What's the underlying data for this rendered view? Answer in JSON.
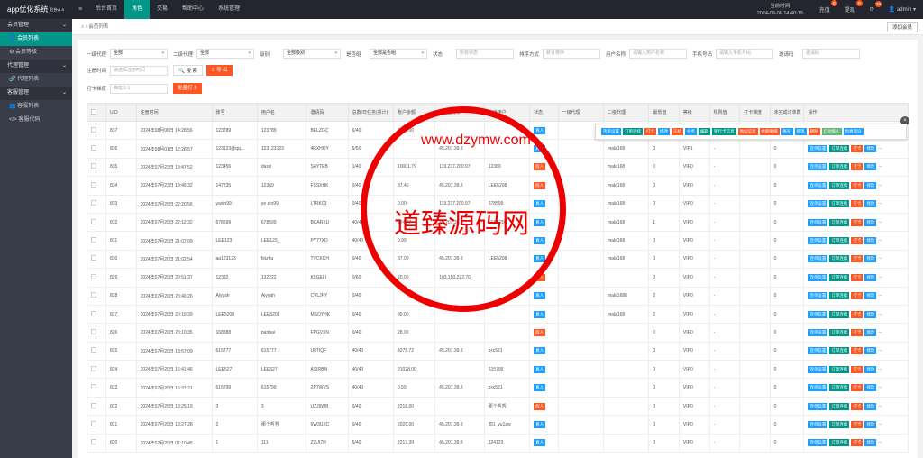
{
  "app": {
    "title": "app优化系统",
    "version": "后台v1.0"
  },
  "topnav": [
    "后台首页",
    "角色",
    "交易",
    "帮助中心",
    "系统管理"
  ],
  "clock": {
    "label": "当前时间",
    "time": "2024-08-06 14:40:19"
  },
  "topright": {
    "recharge": "充值",
    "recharge_count": "0",
    "withdraw": "提现",
    "withdraw_count": "0",
    "msg_count": "19",
    "user": "admin"
  },
  "sidebar": {
    "groups": [
      {
        "label": "会员管理",
        "items": [
          "会员列表",
          "会员等级"
        ]
      },
      {
        "label": "代理管理",
        "items": [
          "代理列表"
        ]
      },
      {
        "label": "客服管理",
        "items": [
          "客服列表",
          "客服代码"
        ]
      }
    ]
  },
  "tabbar": {
    "tab": "会员列表",
    "add": "添加会员"
  },
  "filters": {
    "row1": [
      {
        "label": "一级代理",
        "value": "全部"
      },
      {
        "label": "二级代理",
        "value": "全部"
      },
      {
        "label": "级别",
        "value": "全部级别"
      },
      {
        "label": "是否组",
        "value": "全部是否组"
      },
      {
        "label": "状态",
        "value": "所有状态",
        "ph": true
      },
      {
        "label": "排序方式",
        "value": "默认排序",
        "ph": true
      },
      {
        "label": "用户名称",
        "value": "请输入用户名称",
        "ph": true
      },
      {
        "label": "手机号码",
        "value": "请输入手机号码",
        "ph": true
      },
      {
        "label": "邀请码",
        "value": "邀请码",
        "ph": true
      }
    ],
    "reg_label": "注册时间",
    "reg_ph": "请选择注册时间",
    "search": "搜 索",
    "export": "导 出",
    "print_label": "打卡梯度",
    "print_value": "梯度 1.1",
    "batch": "批量打卡"
  },
  "table": {
    "headers": [
      "UID",
      "注册时间",
      "账号",
      "用户名",
      "邀请码",
      "总数/日任务(累计)",
      "账户余额",
      "最后登录ip",
      "上级用户",
      "状态",
      "一级代理",
      "二级代理",
      "最低值",
      "等级",
      "规则值",
      "打卡梯度",
      "未完成订单数",
      "操作"
    ],
    "rows": [
      [
        "837",
        "2024年08月06日 14:28:56",
        "123789",
        "123789",
        "BELZGC",
        "6/40",
        "1034.00",
        "",
        "",
        "真人",
        "",
        "",
        "0",
        "VIP0",
        "-",
        "",
        "0"
      ],
      [
        "836",
        "2024年08月01日 12:28:57",
        "123123@qq...",
        "123123123",
        "4RXHOY",
        "5/50",
        "",
        "45.207.39.3",
        "",
        "真人",
        "",
        "mala168",
        "0",
        "VIP1",
        "-",
        "",
        "0"
      ],
      [
        "835",
        "2024年07月23日 19:47:52",
        "123456",
        "dasd",
        "SAYTEB",
        "1/40",
        "10001.79",
        "119.237.200.97",
        "12369",
        "假人",
        "",
        "mala168",
        "0",
        "VIP0",
        "-",
        "",
        "0"
      ],
      [
        "834",
        "2024年07月23日 19:46:32",
        "147235",
        "12369",
        "FSSXHK",
        "0/40",
        "37.46",
        "45.207.39.3",
        "LEE5208",
        "假人",
        "",
        "mala168",
        "0",
        "VIP0",
        "-",
        "",
        "0"
      ],
      [
        "833",
        "2024年07月20日 22:20:56",
        "yaxin99",
        "ye sto99",
        "LTRK03",
        "0/40",
        "0.00",
        "119.237.200.97",
        "678599",
        "真人",
        "",
        "mala168",
        "0",
        "VIP0",
        "-",
        "",
        "0"
      ],
      [
        "832",
        "2024年07月20日 22:12:32",
        "678599",
        "678599",
        "BCARXU",
        "40/40",
        "124.77",
        "45.207.39.3",
        "LEE5208",
        "真人",
        "",
        "mala168",
        "1",
        "VIP0",
        "-",
        "",
        "0"
      ],
      [
        "831",
        "2024年07月20日 21:07:09",
        "LEE123",
        "LEE123_",
        "PY77XD",
        "40/40",
        "0.99",
        "",
        "",
        "真人",
        "",
        "mala168",
        "0",
        "VIP0",
        "-",
        "",
        "0"
      ],
      [
        "830",
        "2024年07月20日 21:02:54",
        "aa123123",
        "feizhu",
        "TVCKCH",
        "0/40",
        "37.00",
        "45.207.39.3",
        "LEE5208",
        "真人",
        "",
        "mala168",
        "0",
        "VIP0",
        "-",
        "",
        "0"
      ],
      [
        "829",
        "2024年07月20日 20:51:37",
        "12332",
        "132222",
        "K5GELI",
        "0/60",
        "20.00",
        "103.150.222.70",
        "",
        "假人",
        "",
        "",
        "0",
        "VIP0",
        "-",
        "",
        "0"
      ],
      [
        "828",
        "2024年07月20日 20:46:26",
        "Aiyyah",
        "Aiyyah",
        "CVLJPY",
        "0/40",
        "",
        "",
        "",
        "真人",
        "",
        "mala1688",
        "2",
        "VIP0",
        "-",
        "",
        "0"
      ],
      [
        "827",
        "2024年07月20日 20:19:39",
        "LEE5208",
        "LEE5208",
        "MSQYHK",
        "0/40",
        "30.00",
        "",
        "",
        "真人",
        "",
        "mala168",
        "2",
        "VIP0",
        "-",
        "",
        "0"
      ],
      [
        "826",
        "2024年07月20日 20:10:35",
        "168888",
        "panhai",
        "FPGVXN",
        "0/40",
        "28.00",
        "",
        "",
        "假人",
        "",
        "",
        "0",
        "VIP0",
        "-",
        "",
        "0"
      ],
      [
        "825",
        "2024年07月20日 18:57:09",
        "615777",
        "615777",
        "U8TIQF",
        "40/40",
        "3275.72",
        "45.207.39.3",
        "zxc521",
        "真人",
        "",
        "",
        "0",
        "VIP0",
        "-",
        "",
        "0"
      ],
      [
        "824",
        "2024年07月20日 16:41:46",
        "LEE527",
        "LEE527",
        "ASIRBN",
        "40/40",
        "21028.00",
        "",
        "615799",
        "真人",
        "",
        "",
        "0",
        "VIP0",
        "-",
        "",
        "0"
      ],
      [
        "823",
        "2024年07月20日 16:37:21",
        "615799",
        "615799",
        "ZP7WVS",
        "40/40",
        "0.59",
        "45.207.39.3",
        "zxc521",
        "真人",
        "",
        "",
        "0",
        "VIP0",
        "-",
        "",
        "0"
      ],
      [
        "822",
        "2024年07月20日 13:25:19",
        "3",
        "3",
        "UZJ9WB",
        "0/40",
        "2218.00",
        "",
        "那个哲哲",
        "假人",
        "",
        "",
        "0",
        "VIP0",
        "-",
        "",
        "0"
      ],
      [
        "821",
        "2024年07月20日 13:27:28",
        "2",
        "那个哲哲",
        "6W3UXC",
        "0/40",
        "2028.00",
        "45.207.39.3",
        "四1_yu1aw",
        "真人",
        "",
        "",
        "0",
        "VIP0",
        "-",
        "",
        "0"
      ],
      [
        "820",
        "2024年07月20日 01:10:45",
        "1",
        "111",
        "Z2UI7H",
        "5/40",
        "2217.39",
        "45.207.39.3",
        "324123",
        "真人",
        "",
        "",
        "0",
        "VIP0",
        "-",
        "",
        "0"
      ]
    ],
    "actions": [
      "连单设置",
      "订单连续",
      "打卡",
      "修改"
    ],
    "more": "..."
  },
  "popup": [
    "连单设置",
    "订单连续",
    "打卡",
    "修改",
    "冻结",
    "业务",
    "编辑",
    "银行卡信息",
    "地址信息",
    "余额明细",
    "账号",
    "提现",
    "删除",
    "启动假人",
    "伪真假设"
  ],
  "watermark": {
    "center": "道臻源码网",
    "url": "www.dzymw.com"
  }
}
